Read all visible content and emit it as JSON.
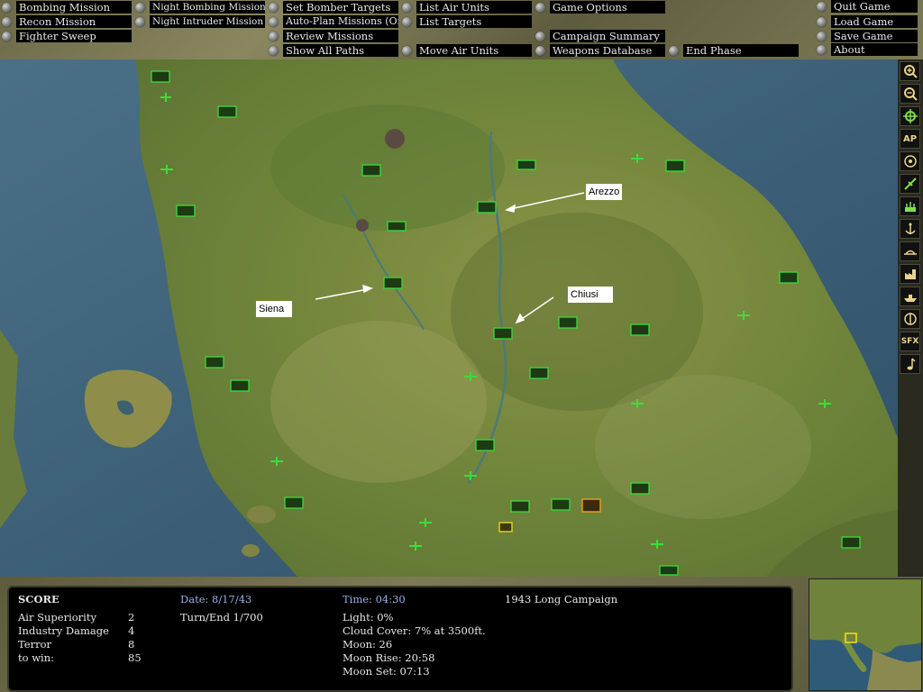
{
  "menu": {
    "bombing_mission": "Bombing Mission",
    "recon_mission": "Recon Mission",
    "fighter_sweep": "Fighter Sweep",
    "night_bombing_mission": "Night Bombing Mission",
    "night_intruder_mission": "Night Intruder Mission",
    "set_bomber_targets": "Set Bomber Targets",
    "auto_plan": "Auto-Plan Missions (Off)",
    "review_missions": "Review Missions",
    "show_all_paths": "Show All Paths",
    "list_air_units": "List Air Units",
    "list_targets": "List Targets",
    "move_air_units": "Move Air Units",
    "game_options": "Game Options",
    "campaign_summary": "Campaign Summary",
    "weapons_database": "Weapons Database",
    "end_phase": "End Phase",
    "quit_game": "Quit Game",
    "load_game": "Load Game",
    "save_game": "Save Game",
    "about": "About"
  },
  "map": {
    "callouts": {
      "arezzo": "Arezzo",
      "siena": "Siena",
      "chiusi": "Chiusi"
    }
  },
  "toolbar": {
    "zoom_in": "zoom-in-icon",
    "zoom_out": "zoom-out-icon",
    "center": "crosshair-icon",
    "ap_label": "AP",
    "sfx_label": "SFX"
  },
  "status": {
    "score_title": "SCORE",
    "rows": [
      {
        "label": "Air Superiority",
        "value": "2"
      },
      {
        "label": "Industry Damage",
        "value": "4"
      },
      {
        "label": "Terror",
        "value": "8"
      },
      {
        "label": "to win:",
        "value": "85"
      }
    ],
    "date": "Date: 8/17/43",
    "turn": "Turn/End 1/700",
    "time": "Time: 04:30",
    "light": "Light: 0%",
    "cloud": "Cloud Cover: 7% at 3500ft.",
    "moon": "Moon: 26",
    "moon_rise": "Moon Rise: 20:58",
    "moon_set": "Moon Set: 07:13",
    "campaign": "1943 Long Campaign"
  },
  "colors": {
    "unit_green": "#3bdc3b",
    "sea": "#3b5f78",
    "land": "#7a8a3c"
  }
}
